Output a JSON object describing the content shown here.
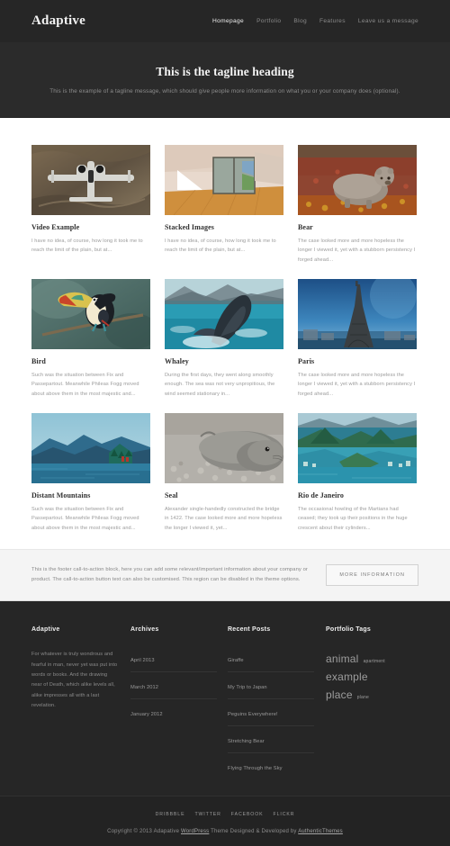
{
  "header": {
    "brand": "Adaptive",
    "nav": [
      {
        "label": "Homepage",
        "active": true
      },
      {
        "label": "Portfolio",
        "active": false
      },
      {
        "label": "Blog",
        "active": false
      },
      {
        "label": "Features",
        "active": false
      },
      {
        "label": "Leave us a message",
        "active": false
      }
    ]
  },
  "hero": {
    "title": "This is the tagline heading",
    "subtitle": "This is the example of a tagline message, which should give people more information on what you or your company does (optional)."
  },
  "portfolio": {
    "items": [
      {
        "title": "Video Example",
        "excerpt": "I have no idea, of course, how long it took me to reach the limit of the plain, but at...",
        "image": "warplane-aerial"
      },
      {
        "title": "Stacked Images",
        "excerpt": "I have no idea, of course, how long it took me to reach the limit of the plain, but at...",
        "image": "modern-interior"
      },
      {
        "title": "Bear",
        "excerpt": "The case looked more and more hopeless the longer I viewed it, yet with a stubborn persistency I forged ahead...",
        "image": "grizzly-bear-tundra"
      },
      {
        "title": "Bird",
        "excerpt": "Such was the situation between Fix and Passepartout. Meanwhile Phileas Fogg moved about above them in the most majestic and...",
        "image": "toucan-branch"
      },
      {
        "title": "Whaley",
        "excerpt": "During the first days, they went along smoothly enough. The sea was not very unpropitious, the wind seemed stationary in...",
        "image": "breaching-whale"
      },
      {
        "title": "Paris",
        "excerpt": "The case looked more and more hopeless the longer I viewed it, yet with a stubborn persistency I forged ahead...",
        "image": "eiffel-tower"
      },
      {
        "title": "Distant Mountains",
        "excerpt": "Such was the situation between Fix and Passepartout. Meanwhile Phileas Fogg moved about above them in the most majestic and...",
        "image": "blue-mountains-lake"
      },
      {
        "title": "Seal",
        "excerpt": "Alexander single-handedly constructed the bridge in 1422. The case looked more and more hopeless the longer I viewed it, yet...",
        "image": "seal-on-beach"
      },
      {
        "title": "Rio de Janeiro",
        "excerpt": "The occasional howling of the Martians had ceased; they took up their positions in the huge crescent about their cylinders...",
        "image": "rio-coastline"
      }
    ]
  },
  "cta": {
    "text": "This is the footer call-to-action block, here you can add some relevant/important information about your company or product. The call-to-action button text can also be customised. This region can be disabled in the theme options.",
    "button_label": "MORE INFORMATION"
  },
  "footer": {
    "about": {
      "title": "Adaptive",
      "text": "For whatever is truly wondrous and fearful in man, never yet was put into words or books. And the drawing near of Death, which alike levels all, alike impresses all with a last revelation."
    },
    "archives": {
      "title": "Archives",
      "items": [
        "April 2013",
        "March 2012",
        "January 2012"
      ]
    },
    "recent_posts": {
      "title": "Recent Posts",
      "items": [
        "Giraffe",
        "My Trip to Japan",
        "Peguins Everywhere!",
        "Stretching Bear",
        "Flying Through the Sky"
      ]
    },
    "portfolio_tags": {
      "title": "Portfolio Tags",
      "tags": [
        {
          "label": "animal",
          "size": "large"
        },
        {
          "label": "apartment",
          "size": "small"
        },
        {
          "label": "example place",
          "size": "large"
        },
        {
          "label": "plane",
          "size": "small"
        }
      ]
    }
  },
  "bottom": {
    "social": [
      "DRIBBBLE",
      "TWITTER",
      "FACEBOOK",
      "FLICKR"
    ],
    "copyright_prefix": "Copyright © 2013 Adapative ",
    "copyright_link1": "WordPress",
    "copyright_middle": " Theme Designed & Developed by ",
    "copyright_link2": "AuthenticThemes"
  },
  "colors": {
    "nav_bg": "#262626",
    "hero_bg": "#2b2b2b",
    "body_bg": "#ffffff",
    "cta_bg": "#f4f4f4",
    "footer_bg": "#262626",
    "bottom_bg": "#232323",
    "text_muted": "#9a9a9a",
    "heading": "#2f2f2f"
  }
}
